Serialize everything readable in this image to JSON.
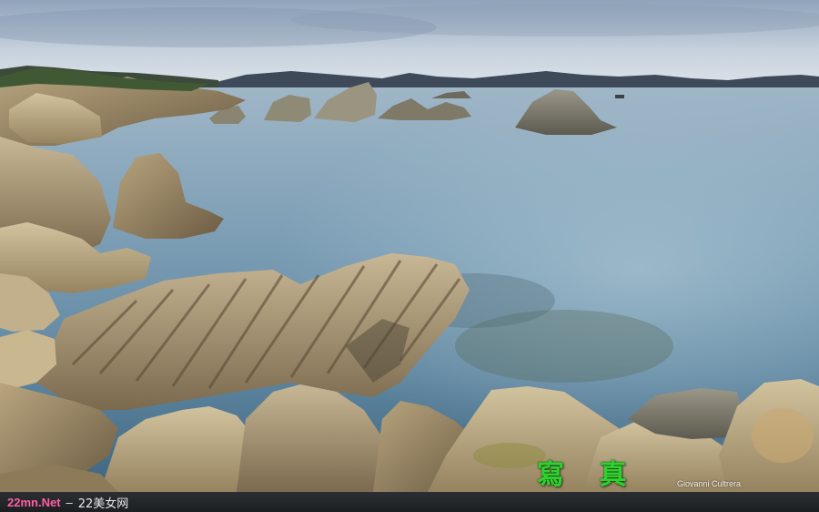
{
  "photo": {
    "description_icon": "landscape-photo",
    "watermark_chinese": "寫 真",
    "credit": "Giovanni Cultrera",
    "colors": {
      "sky": "#b9c6d6",
      "water": "#6f93ad",
      "rock": "#a89470",
      "watermark": "#2fd12f"
    }
  },
  "footer": {
    "domain": "22mn.Net",
    "separator": "–",
    "site_name": "22美女网",
    "colors": {
      "domain": "#ff5fa2",
      "text": "#e8e8e8"
    }
  }
}
